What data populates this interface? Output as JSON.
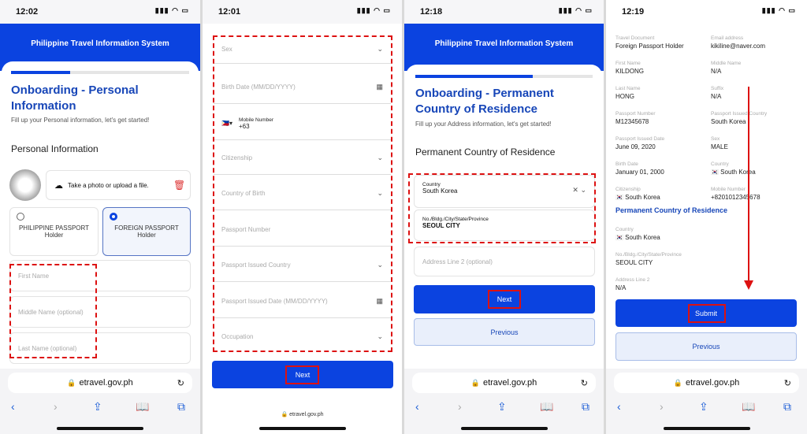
{
  "colors": {
    "brand": "#0b43e0",
    "annotation": "#dd1111"
  },
  "browser": {
    "url": "etravel.gov.ph"
  },
  "panel1": {
    "time": "12:02",
    "battery": "29",
    "header": "Philippine Travel Information System",
    "progress": 0.33,
    "title": "Onboarding - Personal Information",
    "subtitle": "Fill up your Personal information, let's get started!",
    "section": "Personal Information",
    "upload": "Take a photo or upload a file.",
    "radio_ph": "PHILIPPINE PASSPORT Holder",
    "radio_foreign": "FOREIGN PASSPORT Holder",
    "selected": "FOREIGN PASSPORT Holder",
    "first_name": "First Name",
    "middle_name": "Middle Name (optional)",
    "last_name": "Last Name (optional)"
  },
  "panel2": {
    "time": "12:01",
    "battery": "29",
    "sex": "Sex",
    "birth_date": "Birth Date (MM/DD/YYYY)",
    "mobile_label": "Mobile Number",
    "mobile_code": "+63",
    "citizenship": "Citizenship",
    "country_of_birth": "Country of Birth",
    "passport_number": "Passport Number",
    "passport_country": "Passport Issued Country",
    "passport_date": "Passport Issued Date (MM/DD/YYYY)",
    "occupation": "Occupation",
    "next": "Next"
  },
  "panel3": {
    "time": "12:18",
    "battery": "26",
    "header": "Philippine Travel Information System",
    "progress": 0.66,
    "title": "Onboarding - Permanent Country of Residence",
    "subtitle": "Fill up your Address information, let's get started!",
    "section": "Permanent Country of Residence",
    "country_label": "Country",
    "country_value": "South Korea",
    "address_label": "No./Bldg./City/State/Province",
    "address_value": "SEOUL CITY",
    "address2": "Address Line 2 (optional)",
    "next": "Next",
    "previous": "Previous"
  },
  "panel4": {
    "time": "12:19",
    "battery": "26",
    "review": [
      {
        "label": "Travel Document",
        "value": "Foreign Passport Holder"
      },
      {
        "label": "Email address",
        "value": "kikiline@naver.com"
      },
      {
        "label": "First Name",
        "value": "KILDONG"
      },
      {
        "label": "Middle Name",
        "value": "N/A"
      },
      {
        "label": "Last Name",
        "value": "HONG"
      },
      {
        "label": "Suffix",
        "value": "N/A"
      },
      {
        "label": "Passport Number",
        "value": "M12345678"
      },
      {
        "label": "Passport Issued Country",
        "value": "South Korea"
      },
      {
        "label": "Passport Issued Date",
        "value": "June 09, 2020"
      },
      {
        "label": "Sex",
        "value": "MALE"
      },
      {
        "label": "Birth Date",
        "value": "January 01, 2000"
      },
      {
        "label": "Country",
        "value": "🇰🇷 South Korea"
      },
      {
        "label": "Citizenship",
        "value": "🇰🇷 South Korea"
      },
      {
        "label": "Mobile Number",
        "value": "+8201012345678"
      }
    ],
    "residence_heading": "Permanent Country of Residence",
    "residence": [
      {
        "label": "Country",
        "value": "🇰🇷 South Korea"
      },
      {
        "label": "No./Bldg./City/State/Province",
        "value": "SEOUL CITY"
      },
      {
        "label": "Address Line 2",
        "value": "N/A"
      }
    ],
    "submit": "Submit",
    "previous": "Previous"
  }
}
